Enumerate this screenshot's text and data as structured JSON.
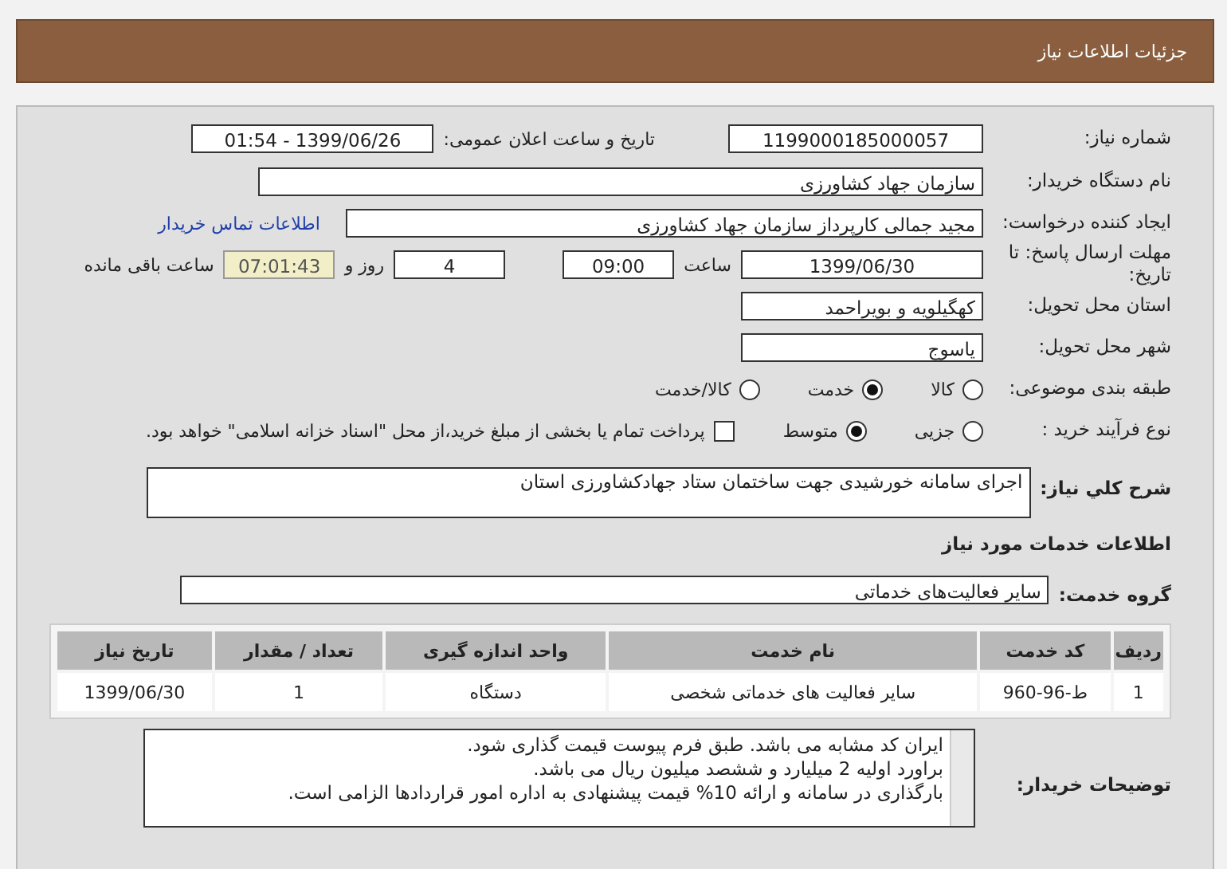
{
  "header": {
    "title": "جزئیات اطلاعات نیاز"
  },
  "need_number": {
    "label": "شماره نیاز:",
    "value": "1199000185000057"
  },
  "announce": {
    "label": "تاریخ و ساعت اعلان عمومی:",
    "value": "1399/06/26 - 01:54"
  },
  "buyer_org": {
    "label": "نام دستگاه خریدار:",
    "value": "سازمان جهاد کشاورزی"
  },
  "creator": {
    "label": "ایجاد کننده درخواست:",
    "value": "مجید جمالی کارپرداز سازمان جهاد کشاورزی",
    "link": "اطلاعات تماس خریدار"
  },
  "deadline": {
    "label": "مهلت ارسال پاسخ: تا تاریخ:",
    "date": "1399/06/30",
    "time_label": "ساعت",
    "time": "09:00",
    "days": "4",
    "days_label": "روز و",
    "remaining": "07:01:43",
    "remaining_label": "ساعت باقی مانده"
  },
  "province": {
    "label": "استان محل تحویل:",
    "value": "کهگیلویه و بویراحمد"
  },
  "city": {
    "label": "شهر محل تحویل:",
    "value": "یاسوج"
  },
  "category": {
    "label": "طبقه بندی موضوعی:",
    "options": [
      {
        "label": "کالا",
        "selected": false
      },
      {
        "label": "خدمت",
        "selected": true
      },
      {
        "label": "کالا/خدمت",
        "selected": false
      }
    ]
  },
  "process": {
    "label": "نوع فرآیند خرید :",
    "options": [
      {
        "label": "جزیی",
        "selected": false
      },
      {
        "label": "متوسط",
        "selected": true
      }
    ],
    "payment": {
      "checked": false,
      "label": "پرداخت تمام یا بخشی از مبلغ خرید،از محل \"اسناد خزانه اسلامی\" خواهد بود."
    }
  },
  "description": {
    "label": "شرح کلي نياز:",
    "value": "اجرای سامانه خورشیدی جهت ساختمان ستاد جهادکشاورزی استان"
  },
  "services_heading": "اطلاعات خدمات مورد نیاز",
  "service_group": {
    "label": "گروه خدمت:",
    "value": "سایر فعالیت‌های خدماتی"
  },
  "table": {
    "columns": [
      "ردیف",
      "کد خدمت",
      "نام خدمت",
      "واحد اندازه گیری",
      "تعداد / مقدار",
      "تاریخ نیاز"
    ],
    "rows": [
      [
        "1",
        "ط-96-960",
        "سایر فعالیت های خدماتی شخصی",
        "دستگاه",
        "1",
        "1399/06/30"
      ]
    ]
  },
  "buyer_notes": {
    "label": "توضیحات خریدار:",
    "lines": [
      "ایران کد مشابه می باشد. طبق فرم پیوست قیمت گذاری شود.",
      "براورد اولیه 2 میلیارد و ششصد میلیون ریال می باشد.",
      "بارگذاری در سامانه و ارائه 10%  قیمت پیشنهادی به اداره امور قراردادها الزامی است."
    ]
  }
}
